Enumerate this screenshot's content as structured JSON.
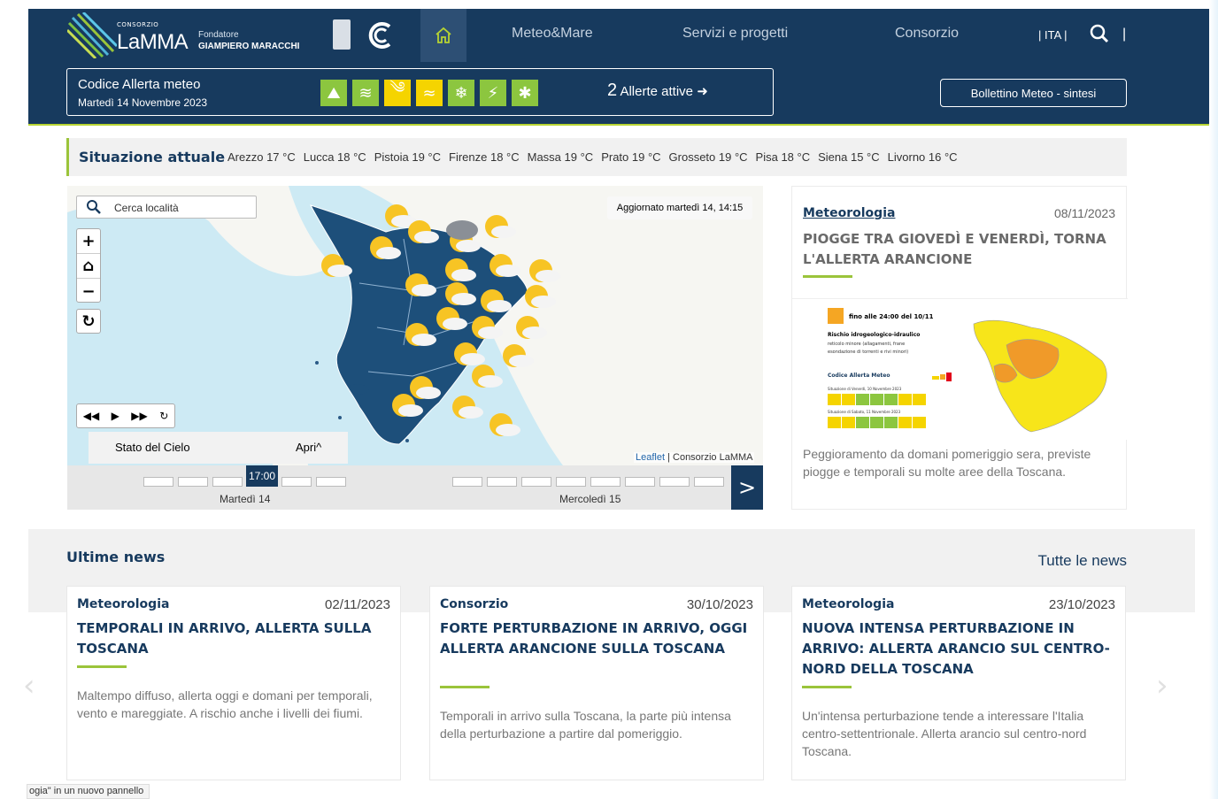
{
  "header": {
    "logo": {
      "consorzio": "CONSORZIO",
      "name": "LaMMA",
      "fondatore": "Fondatore",
      "founder": "GIAMPIERO MARACCHI"
    },
    "nav": [
      "Meteo&Mare",
      "Servizi e progetti",
      "Consorzio"
    ],
    "lang": "| ITA |",
    "sep": "|"
  },
  "alert": {
    "title": "Codice Allerta meteo",
    "date": "Martedì 14 Novembre 2023",
    "icons": [
      {
        "name": "idrogeologico-icon",
        "color": "#8cc63f"
      },
      {
        "name": "idraulico-icon",
        "color": "#8cc63f"
      },
      {
        "name": "vento-icon",
        "color": "#f5d400"
      },
      {
        "name": "mareggiate-icon",
        "color": "#f5d400"
      },
      {
        "name": "neve-icon",
        "color": "#8cc63f"
      },
      {
        "name": "temporali-icon",
        "color": "#8cc63f"
      },
      {
        "name": "ghiaccio-icon",
        "color": "#8cc63f"
      }
    ],
    "count": "2",
    "active_label": "Allerte attive",
    "bollettino": "Bollettino Meteo - sintesi"
  },
  "situazione": {
    "label": "Situazione attuale",
    "cities": [
      "Arezzo 17 °C",
      "Lucca 18 °C",
      "Pistoia 19 °C",
      "Firenze 18 °C",
      "Massa 19 °C",
      "Prato 19 °C",
      "Grosseto 19 °C",
      "Pisa 18 °C",
      "Siena 15 °C",
      "Livorno 16 °C"
    ]
  },
  "map": {
    "search_placeholder": "Cerca località",
    "updated": "Aggiornato martedì 14, 14:15",
    "layer": "Stato del Cielo",
    "open": "Apri^",
    "attribution_link": "Leaflet",
    "attribution": " | Consorzio LaMMA",
    "time_now": "17:00",
    "day1": "Martedì 14",
    "day2": "Mercoledì 15",
    "next": ">"
  },
  "featured": {
    "category": "Meteorologia",
    "date": "08/11/2023",
    "title": "PIOGGE TRA GIOVEDÌ E VENERDÌ, TORNA L'ALLERTA ARANCIONE",
    "excerpt": "Peggioramento da domani pomeriggio sera, previste piogge e temporali su molte aree della Toscana.",
    "infographic": {
      "line1": "fino alle 24:00 del 10/11",
      "line2": "Rischio idrogeologico-idraulico",
      "line3": "reticolo minore (allagamenti, frane",
      "line4": "esondazione di torrenti e rivi minori)",
      "line5": "Codice Allerta Meteo",
      "line6": "Situazione di Venerdì, 10 Novembre 2023",
      "line7": "Situazione di Sabato, 11 Novembre 2023"
    }
  },
  "news": {
    "heading": "Ultime news",
    "all": "Tutte le news",
    "items": [
      {
        "category": "Meteorologia",
        "date": "02/11/2023",
        "title": "TEMPORALI IN ARRIVO, ALLERTA SULLA TOSCANA",
        "excerpt": "Maltempo diffuso, allerta oggi e domani per temporali, vento e mareggiate. A rischio anche i livelli dei fiumi."
      },
      {
        "category": "Consorzio",
        "date": "30/10/2023",
        "title": "FORTE PERTURBAZIONE IN ARRIVO, OGGI ALLERTA ARANCIONE SULLA TOSCANA",
        "excerpt": "Temporali in arrivo sulla Toscana, la parte più intensa della perturbazione a partire dal pomeriggio."
      },
      {
        "category": "Meteorologia",
        "date": "23/10/2023",
        "title": "NUOVA INTENSA PERTURBAZIONE IN ARRIVO: ALLERTA ARANCIO SUL CENTRO-NORD DELLA TOSCANA",
        "excerpt": "Un'intensa perturbazione tende a interessare l'Italia centro-settentrionale. Allerta arancio sul centro-nord Toscana."
      }
    ]
  },
  "statusbar": "ogia\" in un nuovo pannello"
}
